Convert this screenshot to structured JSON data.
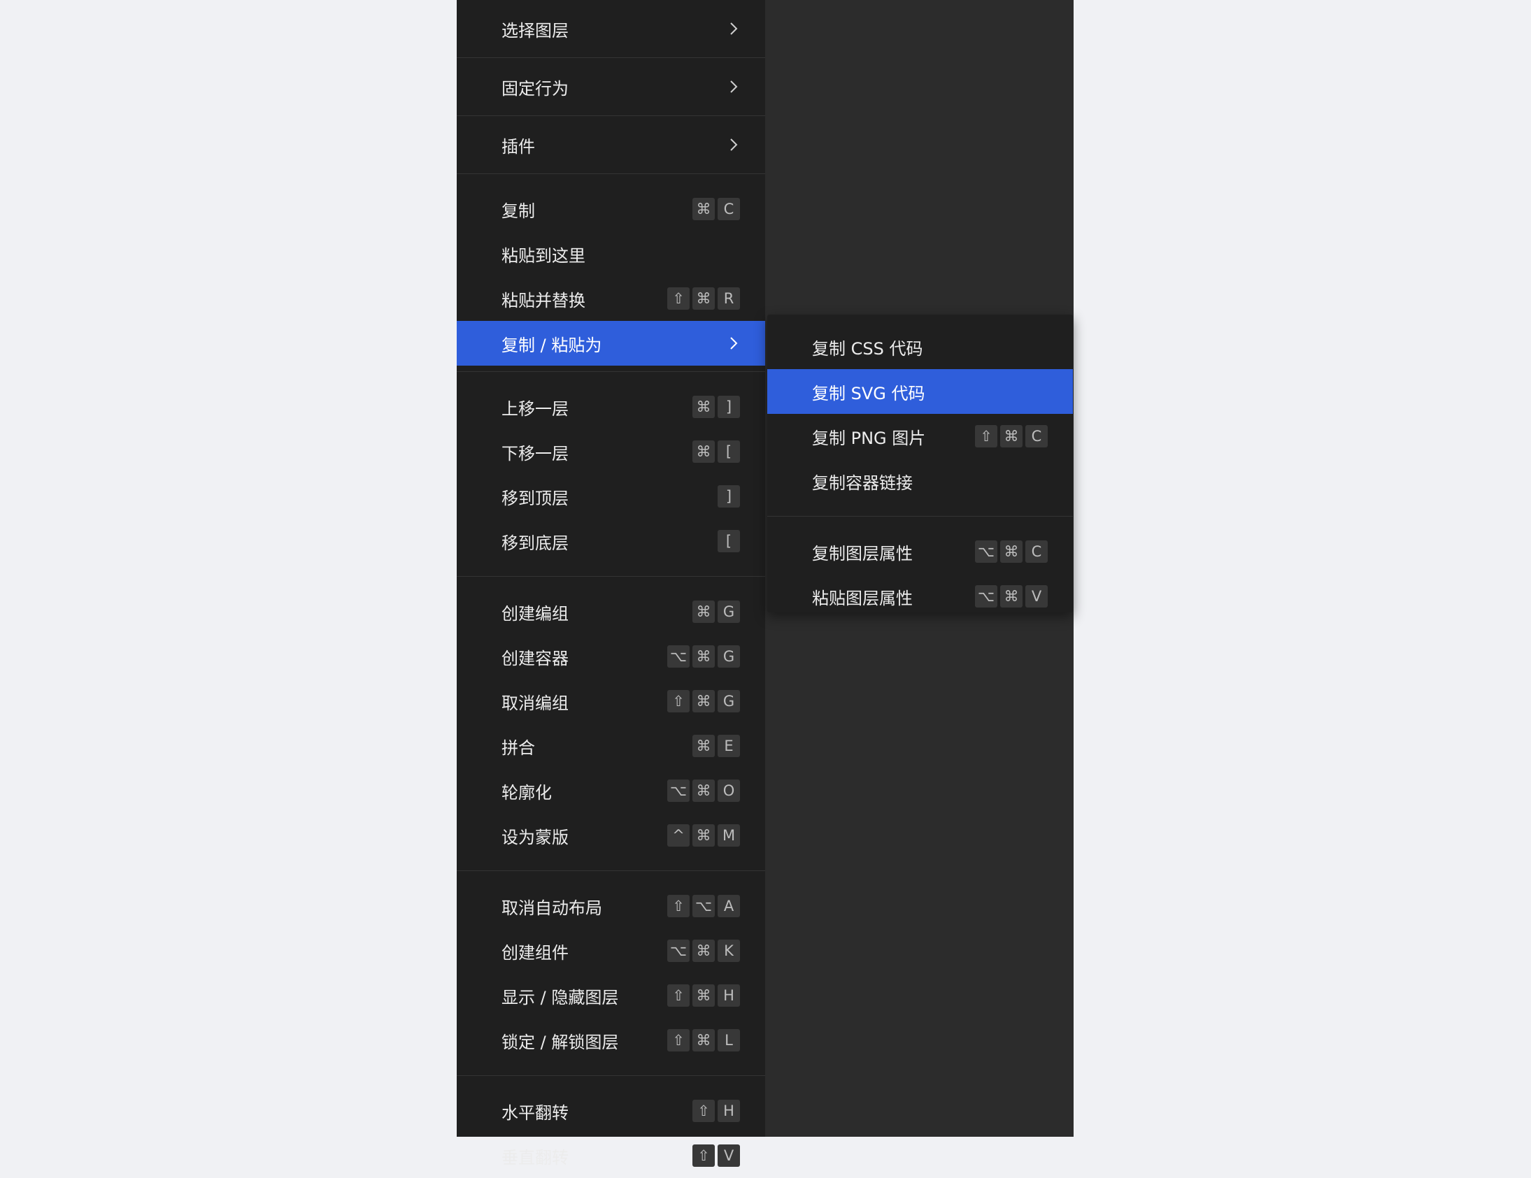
{
  "menu": {
    "groups": [
      [
        {
          "label": "选择图层",
          "submenu": true
        },
        {
          "label": "固定行为",
          "submenu": true
        },
        {
          "label": "插件",
          "submenu": true
        }
      ],
      [
        {
          "label": "复制",
          "keys": [
            "⌘",
            "C"
          ]
        },
        {
          "label": "粘贴到这里",
          "keys": []
        },
        {
          "label": "粘贴并替换",
          "keys": [
            "⇧",
            "⌘",
            "R"
          ]
        },
        {
          "label": "复制 / 粘贴为",
          "submenu": true,
          "active": true
        }
      ],
      [
        {
          "label": "上移一层",
          "keys": [
            "⌘",
            "]"
          ]
        },
        {
          "label": "下移一层",
          "keys": [
            "⌘",
            "["
          ]
        },
        {
          "label": "移到顶层",
          "keys": [
            "]"
          ]
        },
        {
          "label": "移到底层",
          "keys": [
            "["
          ]
        }
      ],
      [
        {
          "label": "创建编组",
          "keys": [
            "⌘",
            "G"
          ]
        },
        {
          "label": "创建容器",
          "keys": [
            "⌥",
            "⌘",
            "G"
          ]
        },
        {
          "label": "取消编组",
          "keys": [
            "⇧",
            "⌘",
            "G"
          ]
        },
        {
          "label": "拼合",
          "keys": [
            "⌘",
            "E"
          ]
        },
        {
          "label": "轮廓化",
          "keys": [
            "⌥",
            "⌘",
            "O"
          ]
        },
        {
          "label": "设为蒙版",
          "keys": [
            "^",
            "⌘",
            "M"
          ]
        }
      ],
      [
        {
          "label": "取消自动布局",
          "keys": [
            "⇧",
            "⌥",
            "A"
          ]
        },
        {
          "label": "创建组件",
          "keys": [
            "⌥",
            "⌘",
            "K"
          ]
        },
        {
          "label": "显示 / 隐藏图层",
          "keys": [
            "⇧",
            "⌘",
            "H"
          ]
        },
        {
          "label": "锁定 / 解锁图层",
          "keys": [
            "⇧",
            "⌘",
            "L"
          ]
        }
      ],
      [
        {
          "label": "水平翻转",
          "keys": [
            "⇧",
            "H"
          ]
        },
        {
          "label": "垂直翻转",
          "keys": [
            "⇧",
            "V"
          ]
        }
      ]
    ]
  },
  "submenu": {
    "groups": [
      [
        {
          "label": "复制 CSS 代码",
          "keys": []
        },
        {
          "label": "复制 SVG 代码",
          "keys": [],
          "active": true
        },
        {
          "label": "复制 PNG 图片",
          "keys": [
            "⇧",
            "⌘",
            "C"
          ]
        },
        {
          "label": "复制容器链接",
          "keys": []
        }
      ],
      [
        {
          "label": "复制图层属性",
          "keys": [
            "⌥",
            "⌘",
            "C"
          ]
        },
        {
          "label": "粘贴图层属性",
          "keys": [
            "⌥",
            "⌘",
            "V"
          ]
        }
      ]
    ]
  },
  "colors": {
    "menu_bg": "#1f1f1f",
    "canvas_bg": "#2c2c2c",
    "page_bg": "#f0f1f4",
    "highlight": "#2f5edb",
    "key_bg": "#383838",
    "text": "#ececec"
  }
}
